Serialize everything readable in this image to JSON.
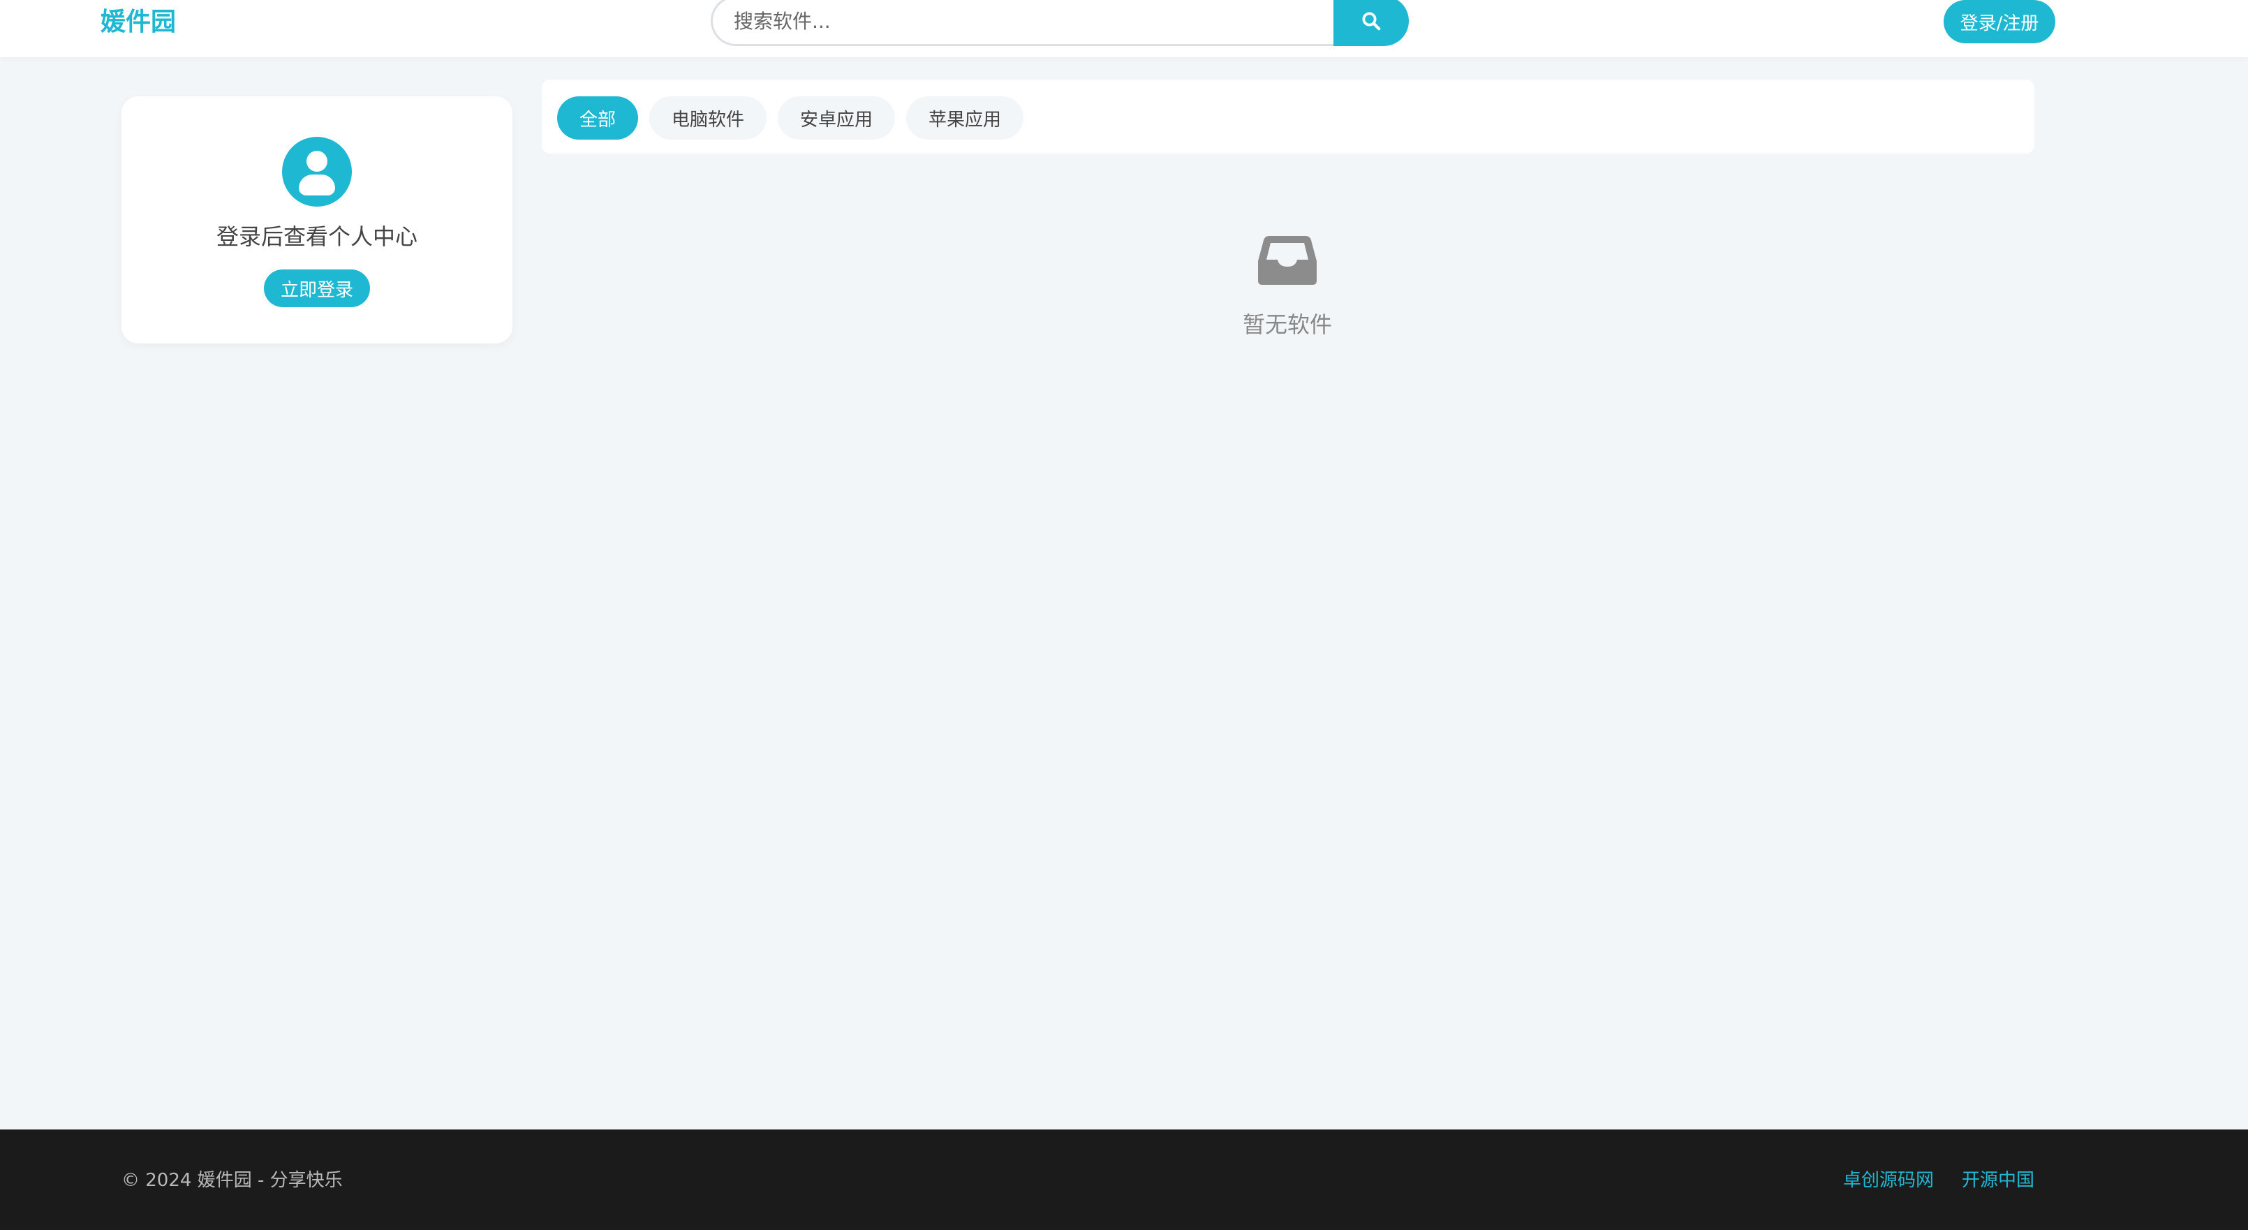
{
  "header": {
    "logo_text": "媛件园",
    "search": {
      "placeholder": "搜索软件...",
      "value": "",
      "button_icon": "search-icon"
    },
    "login_register_label": "登录/注册"
  },
  "user_card": {
    "avatar_icon": "user-icon",
    "tip": "登录后查看个人中心",
    "login_label": "立即登录"
  },
  "tabs": [
    {
      "label": "全部",
      "active": true
    },
    {
      "label": "电脑软件",
      "active": false
    },
    {
      "label": "安卓应用",
      "active": false
    },
    {
      "label": "苹果应用",
      "active": false
    }
  ],
  "empty_state": {
    "icon": "inbox-icon",
    "text": "暂无软件"
  },
  "footer": {
    "copyright": "© 2024 媛件园 - 分享快乐",
    "links": [
      "卓创源码网",
      "开源中国"
    ]
  },
  "colors": {
    "accent": "#1fb8d3",
    "page_background": "#f3f6f9",
    "footer_background": "#1b1b1b"
  }
}
